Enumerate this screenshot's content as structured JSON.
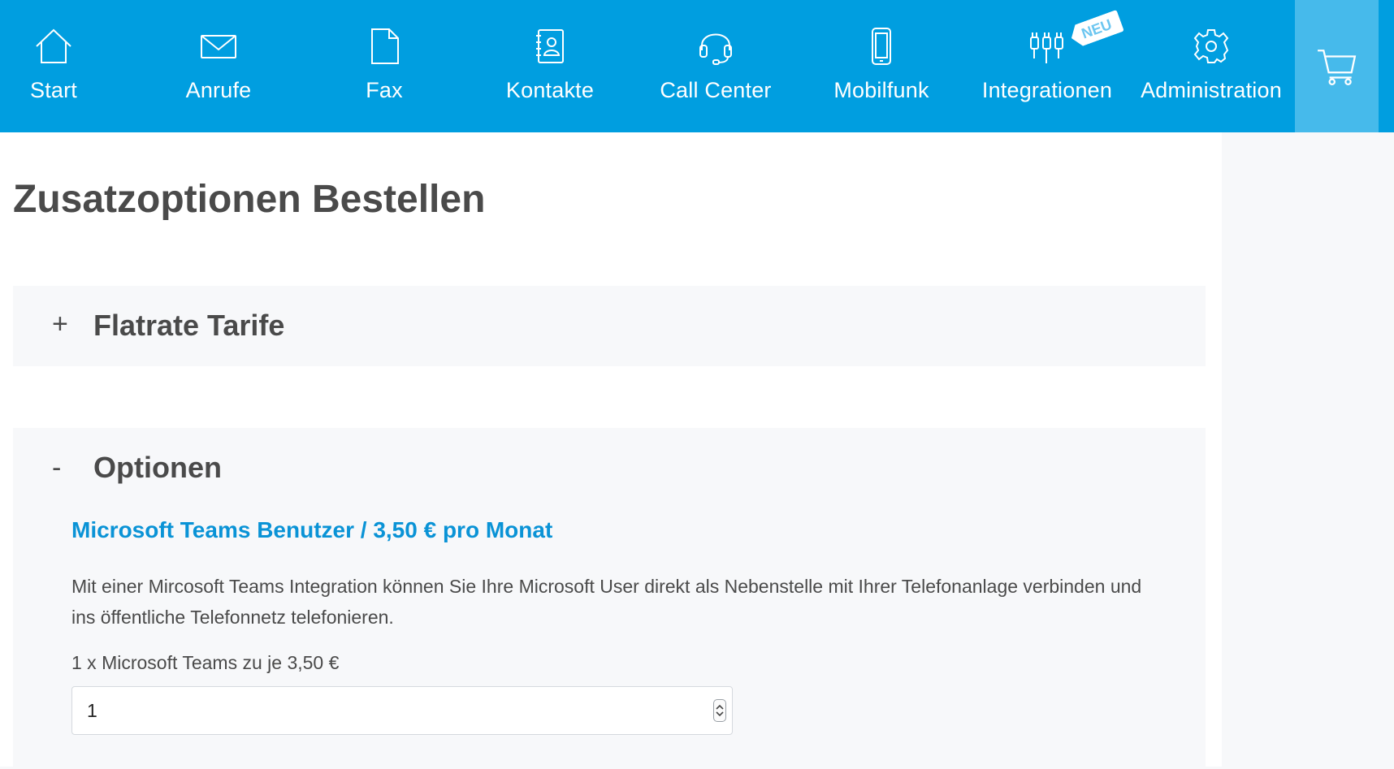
{
  "nav": {
    "items": [
      {
        "label": "Start",
        "icon": "home-icon"
      },
      {
        "label": "Anrufe",
        "icon": "envelope-icon"
      },
      {
        "label": "Fax",
        "icon": "document-icon"
      },
      {
        "label": "Kontakte",
        "icon": "contacts-book-icon"
      },
      {
        "label": "Call Center",
        "icon": "headset-icon"
      },
      {
        "label": "Mobilfunk",
        "icon": "mobile-phone-icon"
      },
      {
        "label": "Integrationen",
        "icon": "plugs-icon",
        "badge": "NEU"
      },
      {
        "label": "Administration",
        "icon": "gear-icon"
      }
    ],
    "cart_icon": "shopping-cart-icon"
  },
  "page": {
    "title": "Zusatzoptionen Bestellen"
  },
  "panels": {
    "flatrate": {
      "toggle": "+",
      "title": "Flatrate Tarife"
    },
    "optionen": {
      "toggle": "-",
      "title": "Optionen",
      "option_title": "Microsoft Teams Benutzer / 3,50 € pro Monat",
      "description": "Mit einer Mircosoft Teams Integration können Sie Ihre Microsoft User direkt als Nebenstelle mit Ihrer Telefonanlage verbinden und ins öffentliche Telefonnetz telefonieren.",
      "quantity_label": "1 x Microsoft Teams zu je 3,50 €",
      "quantity_value": "1"
    }
  },
  "colors": {
    "topbar": "#009ee0",
    "cart_box": "#46baeb",
    "accent_text": "#0a93d6",
    "panel_bg": "#f7f8fa"
  }
}
